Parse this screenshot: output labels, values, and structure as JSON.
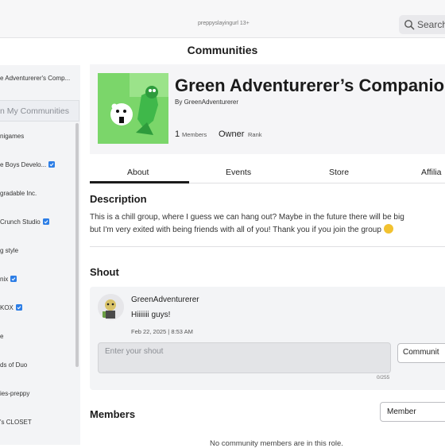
{
  "topbar": {
    "user_label": "preppyslayingurl 13+",
    "search_label": "Search",
    "search_icon": "search-icon"
  },
  "page": {
    "title": "Communities"
  },
  "sidebar": {
    "current_group": "e Adventurerer's Comp...",
    "search_placeholder": "n My Communities",
    "items": [
      {
        "label": "nigames",
        "verified": false
      },
      {
        "label": "e Boys Develo...",
        "verified": true
      },
      {
        "label": "gradable Inc.",
        "verified": false
      },
      {
        "label": "Crunch Studio",
        "verified": true
      },
      {
        "label": "g style",
        "verified": false
      },
      {
        "label": "nix",
        "verified": true
      },
      {
        "label": "KOX",
        "verified": true
      },
      {
        "label": "e",
        "verified": false
      },
      {
        "label": "ds of Duo",
        "verified": false
      },
      {
        "label": "ies-preppy",
        "verified": false
      },
      {
        "label": "'s CLOSET",
        "verified": false
      }
    ]
  },
  "group": {
    "name": "Green Adventurerer’s Companio",
    "owner_prefix": "By ",
    "owner": "GreenAdventurerer",
    "members_count": "1",
    "members_label": "Members",
    "rank_value": "Owner",
    "rank_label": "Rank"
  },
  "tabs": [
    {
      "label": "About",
      "active": true
    },
    {
      "label": "Events",
      "active": false
    },
    {
      "label": "Store",
      "active": false
    },
    {
      "label": "Affilia",
      "active": false
    }
  ],
  "description": {
    "title": "Description",
    "line1": "This is a chill group, where I guess we can hang out? Maybe in the future there will be big",
    "line2": "but I'm very exited with being friends with all of you! Thank you if you join the group"
  },
  "shout": {
    "title": "Shout",
    "user": "GreenAdventurerer",
    "message": "Hiiiiiii guys!",
    "date": "Feb 22, 2025 | 8:53 AM",
    "input_placeholder": "Enter your shout",
    "char_count": "0/255",
    "post_button": "Communit"
  },
  "members": {
    "title": "Members",
    "role_select": "Member",
    "empty_text": "No community members are in this role."
  },
  "colors": {
    "verified_blue": "#2d7ee6",
    "thumb_green": "#7bd66a"
  }
}
